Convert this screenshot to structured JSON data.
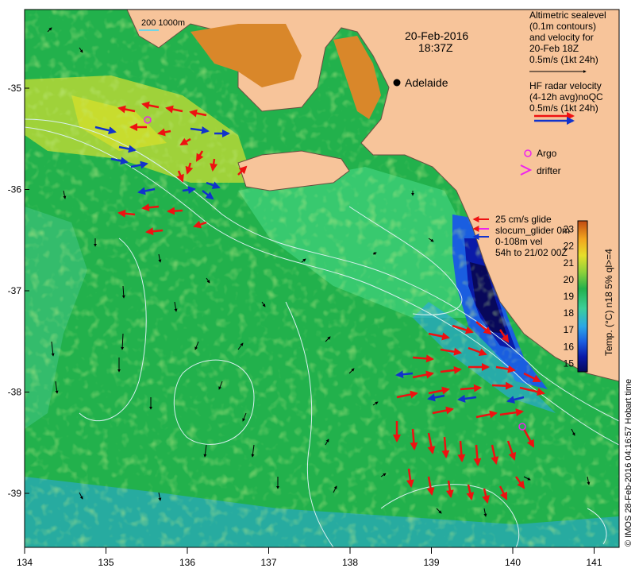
{
  "map": {
    "datetime_line1": "20-Feb-2016",
    "datetime_line2": "18:37Z",
    "scale_label": "200   1000m",
    "city": "Adelaide",
    "colors": {
      "land": "#f7c49a",
      "land_dark": "#d9872a",
      "coast": "#6a5040",
      "ocean_main": "#22b14c",
      "radar_arrow": "#ee1111",
      "radar_arrow_alt": "#1133cc",
      "altimetry_arrow": "#000000",
      "contour": "#d8f0f0",
      "argo": "#ee22ee"
    }
  },
  "legend": {
    "altimetry": [
      "Altimetric sealevel",
      "(0.1m contours)",
      "and velocity for",
      "20-Feb 18Z",
      "0.5m/s (1kt 24h)"
    ],
    "hf_radar": [
      "HF radar velocity",
      "(4-12h avg)noQC",
      "0.5m/s (1kt 24h)"
    ],
    "argo": "Argo",
    "drifter": "drifter",
    "glider": [
      "25 cm/s glide",
      "slocum_glider 0m",
      "0-108m vel",
      "54h to 21/02 00Z"
    ]
  },
  "colorbar": {
    "title": "Temp. (°C) n18 5% ql>=4",
    "ticks": [
      "15",
      "16",
      "17",
      "18",
      "19",
      "20",
      "21",
      "22",
      "23"
    ],
    "min": 14.5,
    "max": 23.5,
    "colors": [
      "#08085a",
      "#0a1aa8",
      "#1a5ee0",
      "#2ba6e6",
      "#3ccf9a",
      "#22b14c",
      "#8ed13a",
      "#e6df2a",
      "#f2a51e",
      "#c14a12"
    ]
  },
  "axes": {
    "x_ticks": [
      "134",
      "135",
      "136",
      "137",
      "138",
      "139",
      "140",
      "141"
    ],
    "y_ticks": [
      "-35",
      "-36",
      "-37",
      "-38",
      "-39"
    ]
  },
  "credit": "© IMOS 28-Feb-2016 04:16:57 Hobart time"
}
